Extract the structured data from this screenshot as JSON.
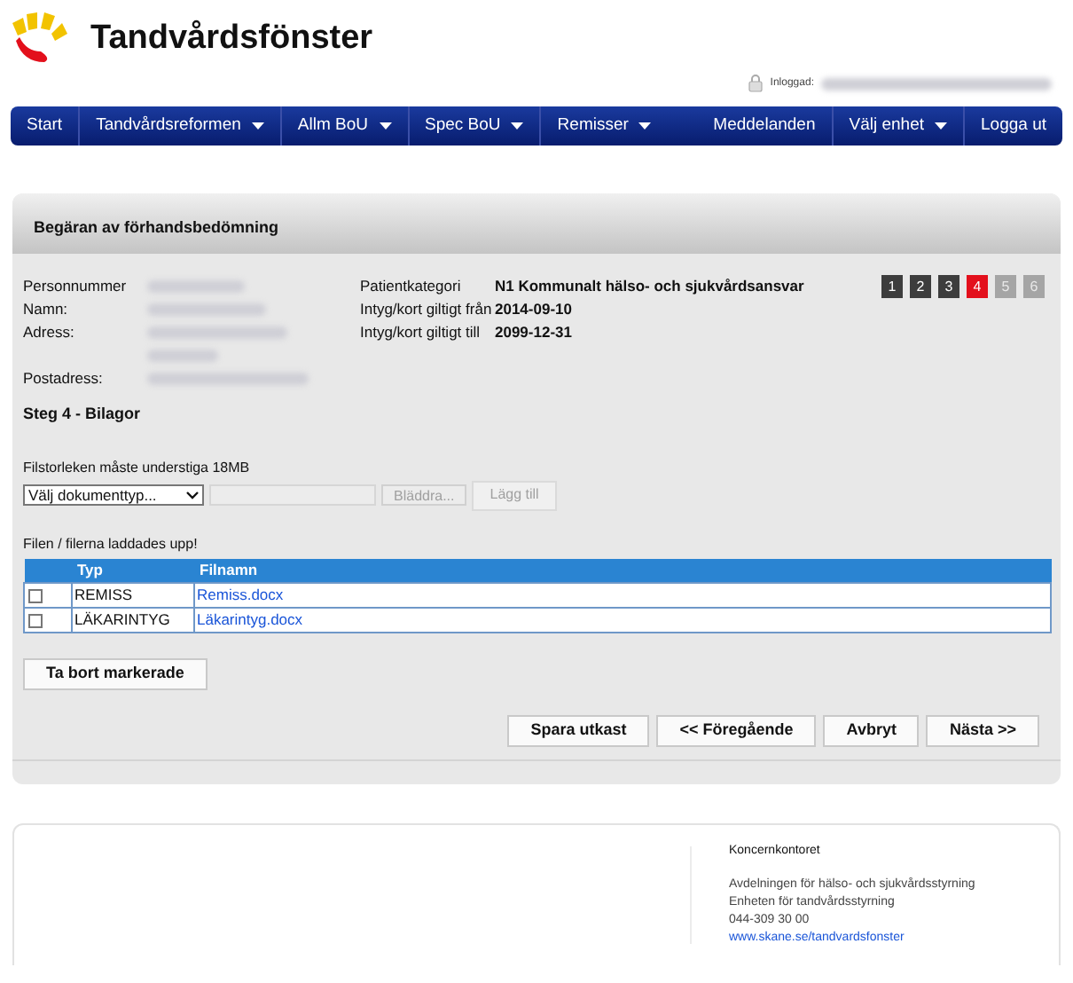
{
  "header": {
    "title": "Tandvårdsfönster",
    "login_label": "Inloggad:"
  },
  "nav": {
    "left": [
      {
        "label": "Start",
        "dropdown": false
      },
      {
        "label": "Tandvårdsreformen",
        "dropdown": true
      },
      {
        "label": "Allm BoU",
        "dropdown": true
      },
      {
        "label": "Spec BoU",
        "dropdown": true
      },
      {
        "label": "Remisser",
        "dropdown": true
      }
    ],
    "right": [
      {
        "label": "Meddelanden",
        "dropdown": false
      },
      {
        "label": "Välj enhet",
        "dropdown": true
      },
      {
        "label": "Logga ut",
        "dropdown": false
      }
    ]
  },
  "panel": {
    "title": "Begäran av förhandsbedömning",
    "patient_fields": [
      {
        "label": "Personnummer",
        "kind": "single"
      },
      {
        "label": "Namn:",
        "kind": "single"
      },
      {
        "label": "Adress:",
        "kind": "double"
      },
      {
        "label": "Postadress:",
        "kind": "single"
      }
    ],
    "info_fields": [
      {
        "label": "Patientkategori",
        "value": "N1 Kommunalt hälso- och sjukvårdsansvar"
      },
      {
        "label": "Intyg/kort giltigt från",
        "value": "2014-09-10"
      },
      {
        "label": "Intyg/kort giltigt till",
        "value": "2099-12-31"
      }
    ],
    "steps": [
      {
        "label": "1",
        "completed": true,
        "selected": false
      },
      {
        "label": "2",
        "completed": true,
        "selected": false
      },
      {
        "label": "3",
        "completed": true,
        "selected": false
      },
      {
        "label": "4",
        "completed": false,
        "selected": true
      },
      {
        "label": "5",
        "completed": false,
        "selected": false
      },
      {
        "label": "6",
        "completed": false,
        "selected": false
      }
    ],
    "step_heading": "Steg 4 - Bilagor",
    "upload": {
      "size_note": "Filstorleken måste understiga 18MB",
      "doc_type": "Välj dokumenttyp...",
      "browse": "Bläddra...",
      "add": "Lägg till"
    },
    "upload_message": "Filen / filerna laddades upp!",
    "table": {
      "columns": [
        "Typ",
        "Filnamn"
      ],
      "rows": [
        {
          "type": "REMISS",
          "file": "Remiss.docx",
          "checked": false
        },
        {
          "type": "LÄKARINTYG",
          "file": "Läkarintyg.docx",
          "checked": false
        }
      ]
    },
    "remove_button": "Ta bort markerade",
    "actions": [
      "Spara utkast",
      "<< Föregående",
      "Avbryt",
      "Nästa >>"
    ]
  },
  "footer": {
    "heading": "Koncernkontoret",
    "lines": [
      "Avdelningen för hälso- och sjukvårdsstyrning",
      "Enheten för tandvårdsstyrning",
      "044-309 30 00"
    ],
    "link": "www.skane.se/tandvardsfonster"
  }
}
